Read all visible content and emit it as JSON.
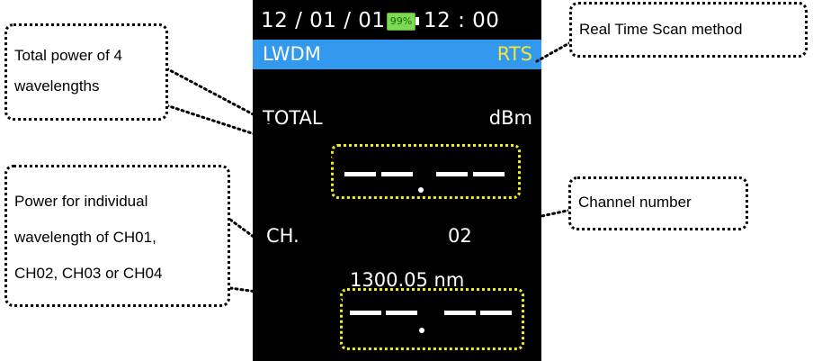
{
  "device": {
    "status_bar": {
      "date": "12 / 01 / 01",
      "battery": "99%",
      "time": "12 : 00"
    },
    "mode_bar": {
      "mode": "LWDM",
      "scan_method": "RTS"
    },
    "total": {
      "label": "TOTAL",
      "unit": "dBm"
    },
    "channel": {
      "label": "CH.",
      "number": "02"
    },
    "wavelength": "1300.05 nm"
  },
  "callouts": {
    "scan_method": "Real Time Scan method",
    "total_power": [
      "Total power of 4",
      "wavelengths"
    ],
    "channel_number": "Channel number",
    "individual_power": [
      "Power for individual",
      "wavelength of CH01,",
      "CH02, CH03 or CH04"
    ]
  },
  "colors": {
    "mode_bar": "#3399ee",
    "scan_method_text": "#f5e63a",
    "highlight_box": "#f0ec2a",
    "battery": "#7ed957"
  }
}
